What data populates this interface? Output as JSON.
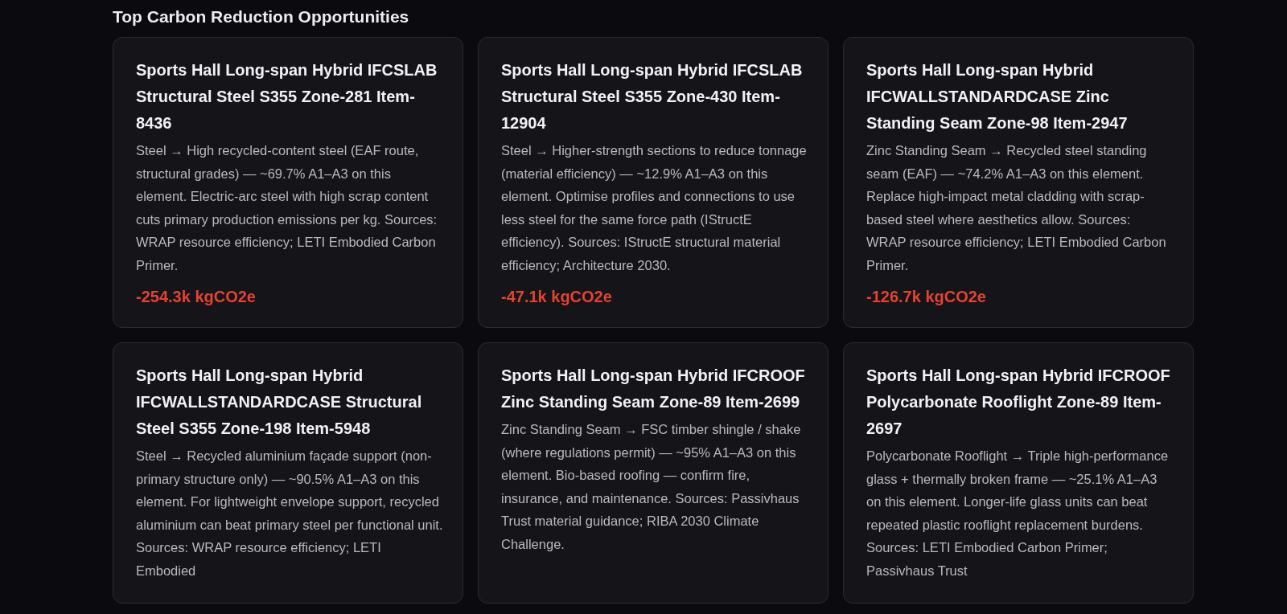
{
  "section": {
    "title": "Top Carbon Reduction Opportunities"
  },
  "cards": [
    {
      "title": "Sports Hall Long-span Hybrid IFCSLAB Structural Steel S355 Zone-281 Item-8436",
      "description": "Steel → High recycled-content steel (EAF route, structural grades) — ~69.7% A1–A3 on this element. Electric-arc steel with high scrap content cuts primary production emissions per kg. Sources: WRAP resource efficiency; LETI Embodied Carbon Primer.",
      "saving": "-254.3k kgCO2e"
    },
    {
      "title": "Sports Hall Long-span Hybrid IFCSLAB Structural Steel S355 Zone-430 Item-12904",
      "description": "Steel → Higher-strength sections to reduce tonnage (material efficiency) — ~12.9% A1–A3 on this element. Optimise profiles and connections to use less steel for the same force path (IStructE efficiency). Sources: IStructE structural material efficiency; Architecture 2030.",
      "saving": "-47.1k kgCO2e"
    },
    {
      "title": "Sports Hall Long-span Hybrid IFCWALLSTANDARDCASE Zinc Standing Seam Zone-98 Item-2947",
      "description": "Zinc Standing Seam → Recycled steel standing seam (EAF) — ~74.2% A1–A3 on this element. Replace high-impact metal cladding with scrap-based steel where aesthetics allow. Sources: WRAP resource efficiency; LETI Embodied Carbon Primer.",
      "saving": "-126.7k kgCO2e"
    },
    {
      "title": "Sports Hall Long-span Hybrid IFCWALLSTANDARDCASE Structural Steel S355 Zone-198 Item-5948",
      "description": "Steel → Recycled aluminium façade support (non-primary structure only) — ~90.5% A1–A3 on this element. For lightweight envelope support, recycled aluminium can beat primary steel per functional unit. Sources: WRAP resource efficiency; LETI Embodied"
    },
    {
      "title": "Sports Hall Long-span Hybrid IFCROOF Zinc Standing Seam Zone-89 Item-2699",
      "description": "Zinc Standing Seam → FSC timber shingle / shake (where regulations permit) — ~95% A1–A3 on this element. Bio-based roofing — confirm fire, insurance, and maintenance. Sources: Passivhaus Trust material guidance; RIBA 2030 Climate Challenge."
    },
    {
      "title": "Sports Hall Long-span Hybrid IFCROOF Polycarbonate Rooflight Zone-89 Item-2697",
      "description": "Polycarbonate Rooflight → Triple high-performance glass + thermally broken frame — ~25.1% A1–A3 on this element. Longer-life glass units can beat repeated plastic rooflight replacement burdens. Sources: LETI Embodied Carbon Primer; Passivhaus Trust"
    }
  ]
}
